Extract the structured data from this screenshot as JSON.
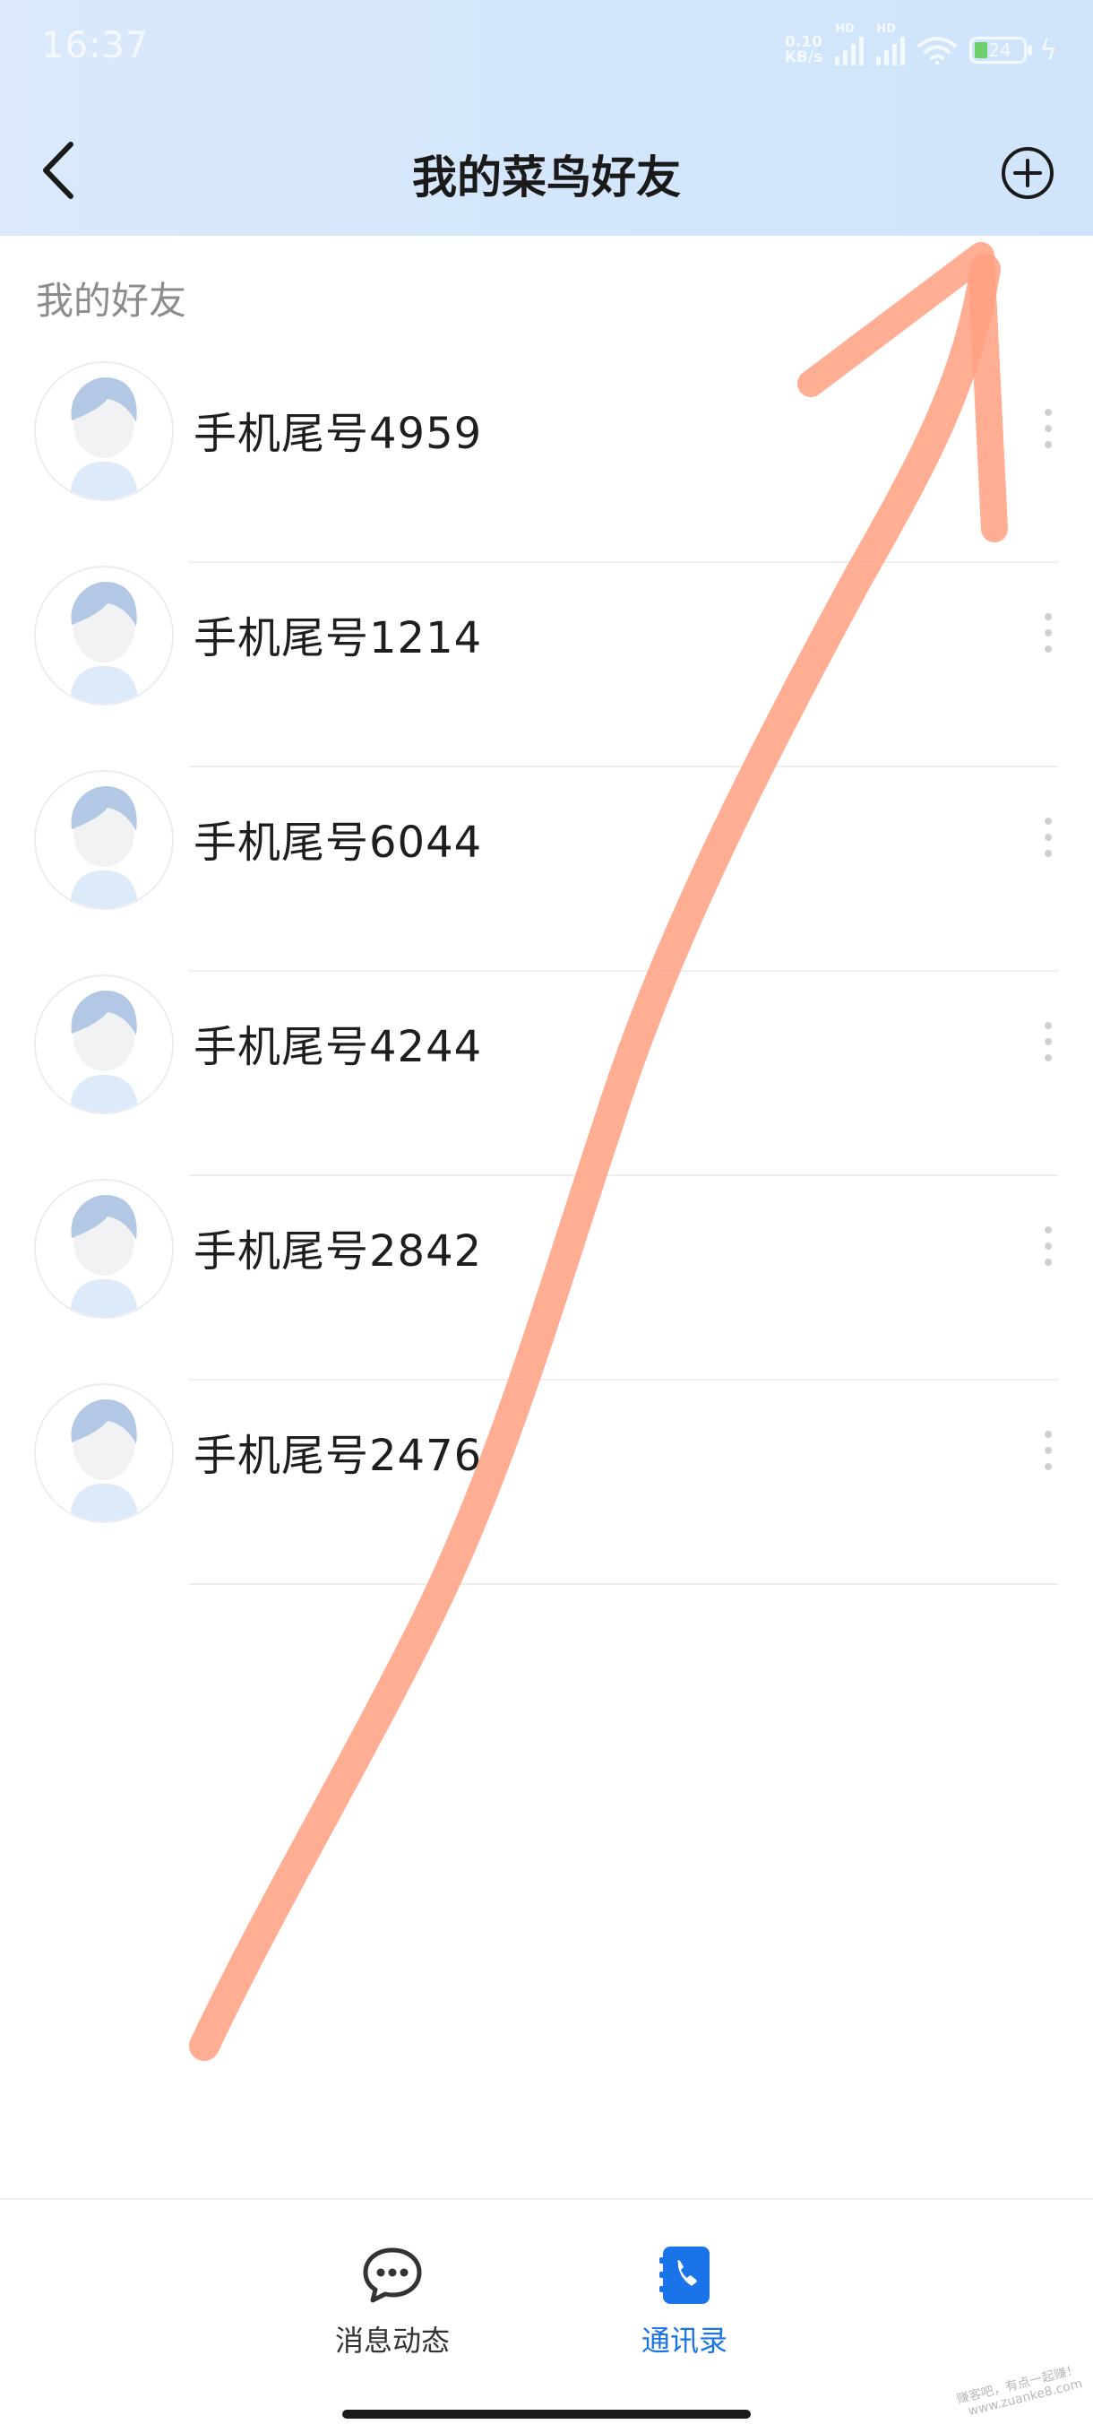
{
  "status_bar": {
    "time": "16:37",
    "net_speed_value": "0.10",
    "net_speed_unit": "KB/s",
    "hd_label_1": "HD",
    "hd_label_2": "HD",
    "battery_level": "24"
  },
  "header": {
    "title": "我的菜鸟好友"
  },
  "section": {
    "label": "我的好友"
  },
  "friends": [
    {
      "name": "手机尾号4959"
    },
    {
      "name": "手机尾号1214"
    },
    {
      "name": "手机尾号6044"
    },
    {
      "name": "手机尾号4244"
    },
    {
      "name": "手机尾号2842"
    },
    {
      "name": "手机尾号2476"
    }
  ],
  "bottom_nav": {
    "tabs": [
      {
        "label": "消息动态",
        "icon": "chat-bubble-icon",
        "active": false
      },
      {
        "label": "通讯录",
        "icon": "phone-book-icon",
        "active": true
      }
    ]
  },
  "colors": {
    "header_bg": "#d3e6fb",
    "accent": "#1a73e8",
    "annotation_arrow": "#ff9f80"
  },
  "watermark": {
    "line1": "赚客吧，有点一起赚！",
    "line2": "www.zuanke8.com"
  }
}
